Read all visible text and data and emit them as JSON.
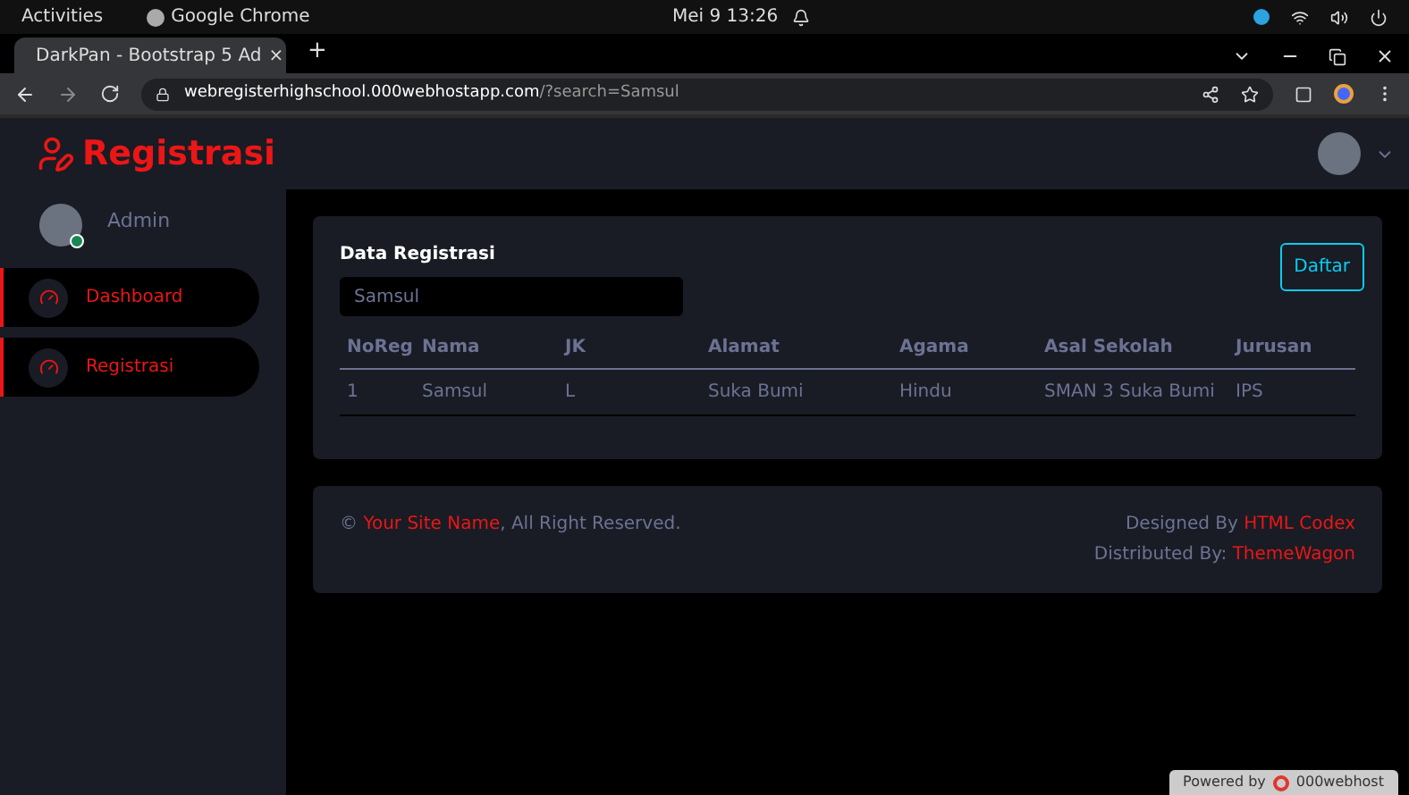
{
  "os_bar": {
    "activities": "Activities",
    "app": "Google Chrome",
    "clock": "Mei 9  13:26"
  },
  "browser": {
    "tabs": [
      {
        "title": "DarkPan - Bootstrap 5 Ad",
        "selected": true
      }
    ],
    "new_tab": "+",
    "close": "×",
    "url_host": "webregisterhighschool.000webhostapp.com",
    "url_path": "/?search=Samsul"
  },
  "brand": "Registrasi",
  "sidebar": {
    "user": "Admin",
    "online": true,
    "items": [
      {
        "label": "Dashboard",
        "selected": false
      },
      {
        "label": "Registrasi",
        "selected": false
      }
    ]
  },
  "card": {
    "title": "Data Registrasi",
    "button": "Daftar",
    "search": {
      "value": "Samsul"
    },
    "table": {
      "columns": [
        "NoReg",
        "Nama",
        "JK",
        "Alamat",
        "Agama",
        "Asal Sekolah",
        "Jurusan"
      ],
      "rows": [
        [
          "1",
          "Samsul",
          "L",
          "Suka Bumi",
          "Hindu",
          "SMAN 3 Suka Bumi",
          "IPS"
        ]
      ]
    }
  },
  "footer": {
    "copyright": "©",
    "site": "Your Site Name",
    "rights": ", All Right Reserved.",
    "designed": "Designed By",
    "designer": "HTML Codex",
    "distributed": "Distributed By:",
    "distributor": "ThemeWagon"
  },
  "badge": {
    "prefix": "Powered by",
    "brand": "000webhost"
  }
}
